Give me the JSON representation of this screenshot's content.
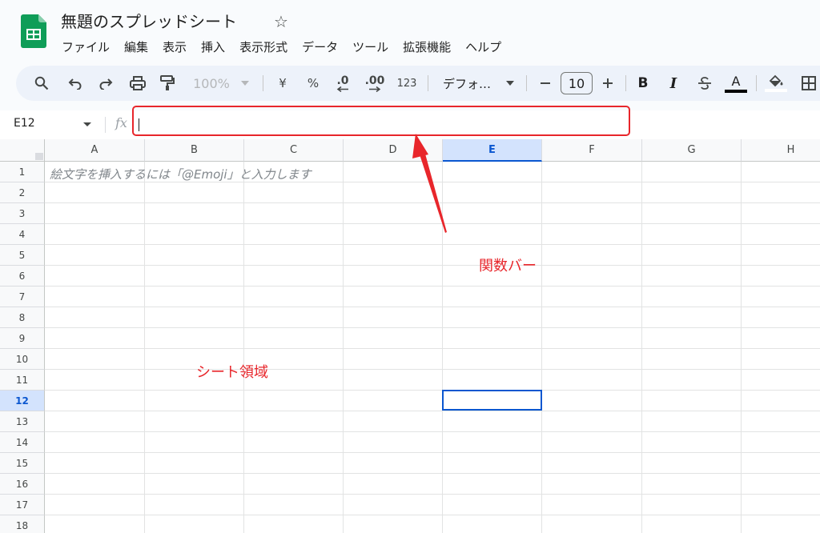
{
  "app": {
    "doc_title": "無題のスプレッドシート",
    "star_glyph": "☆"
  },
  "menu": [
    "ファイル",
    "編集",
    "表示",
    "挿入",
    "表示形式",
    "データ",
    "ツール",
    "拡張機能",
    "ヘルプ"
  ],
  "toolbar": {
    "zoom": "100%",
    "currency": "¥",
    "percent": "%",
    "decrease_decimal": ".0",
    "increase_decimal": ".00",
    "number_format": "123",
    "font": "デフォ…",
    "font_size": "10",
    "bold": "B",
    "italic": "I",
    "text_color_letter": "A",
    "icons": [
      "search-icon",
      "undo-icon",
      "redo-icon",
      "print-icon",
      "paint-format-icon",
      "zoom-dropdown-icon",
      "minus-icon",
      "plus-icon",
      "strikethrough-icon",
      "fill-color-icon",
      "borders-icon"
    ]
  },
  "formula_bar": {
    "name_box": "E12",
    "fx": "fx",
    "value": ""
  },
  "grid": {
    "columns": [
      "A",
      "B",
      "C",
      "D",
      "E",
      "F",
      "G",
      "H"
    ],
    "selected_column": "E",
    "rows": [
      "1",
      "2",
      "3",
      "4",
      "5",
      "6",
      "7",
      "8",
      "9",
      "10",
      "11",
      "12",
      "13",
      "14",
      "15",
      "16",
      "17",
      "18"
    ],
    "selected_row": "12",
    "hint_a1": "絵文字を挿入するには「@Emoji」と入力します"
  },
  "annotations": {
    "function_bar_label": "関数バー",
    "sheet_area_label": "シート領域",
    "color": "#e8262b"
  },
  "colors": {
    "brand_green": "#0f9d58",
    "selection_blue": "#0b57d0",
    "selection_fill": "#d3e3fd"
  }
}
